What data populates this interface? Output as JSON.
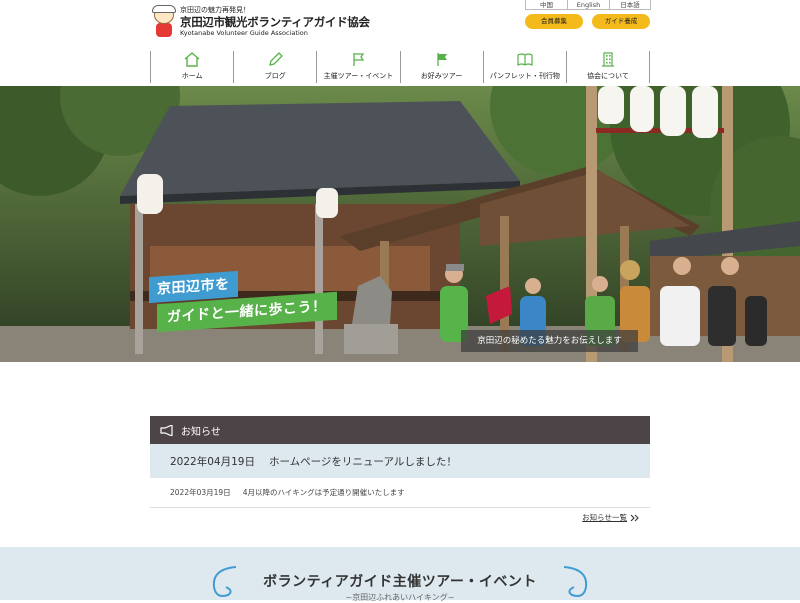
{
  "header": {
    "tagline": "京田辺の魅力再発見！",
    "title": "京田辺市観光ボランティアガイド協会",
    "subtitle": "Kyotanabe Volunteer Guide Association",
    "languages": [
      "中国",
      "English",
      "日本語"
    ],
    "member_recruit": "会員募集",
    "guide_training": "ガイド養成"
  },
  "nav": {
    "items": [
      {
        "label": "ホーム",
        "icon": "home-icon"
      },
      {
        "label": "ブログ",
        "icon": "pencil-icon"
      },
      {
        "label": "主催ツアー・イベント",
        "icon": "flag-icon"
      },
      {
        "label": "お好みツアー",
        "icon": "flag-filled-icon"
      },
      {
        "label": "パンフレット・刊行物",
        "icon": "book-icon"
      },
      {
        "label": "協会について",
        "icon": "building-icon"
      }
    ]
  },
  "hero": {
    "caption_line1": "京田辺市を",
    "caption_line2": "ガイドと一緒に歩こう！",
    "band_text": "京田辺の秘めたる魅力をお伝えします"
  },
  "news": {
    "heading": "お知らせ",
    "items": [
      {
        "date": "2022年04月19日",
        "text": "ホームページをリニューアルしました！"
      },
      {
        "date": "2022年03月19日",
        "text": "4月以降のハイキングは予定通り開催いたします"
      }
    ],
    "more_label": "お知らせ一覧"
  },
  "tour": {
    "title": "ボランティアガイド主催ツアー・イベント",
    "subtitle": "~京田辺ふれあいハイキング~"
  },
  "colors": {
    "accent_yellow": "#f4b91a",
    "nav_green": "#58b24a",
    "caption_blue": "#3f9bd0",
    "news_header": "#4d4448",
    "band_light": "#dde8ef"
  }
}
